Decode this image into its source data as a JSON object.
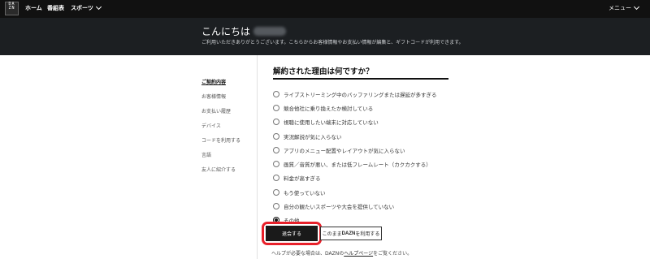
{
  "nav": {
    "logo": [
      "DA",
      "ZN"
    ],
    "home": "ホーム",
    "schedule": "番組表",
    "sports": "スポーツ",
    "menu": "メニュー"
  },
  "header": {
    "greeting": "こんにちは",
    "subtitle": "ご利用いただきありがとうございます。こちらからお客様情報やお支払い情報が編集と、ギフトコードが利用できます。"
  },
  "sidebar": {
    "items": [
      {
        "label": "ご契約内容",
        "active": true
      },
      {
        "label": "お客様情報",
        "active": false
      },
      {
        "label": "お支払い履歴",
        "active": false
      },
      {
        "label": "デバイス",
        "active": false
      },
      {
        "label": "コードを利用する",
        "active": false
      },
      {
        "label": "言語",
        "active": false
      },
      {
        "label": "友人に紹介する",
        "active": false
      }
    ]
  },
  "main": {
    "question": "解約された理由は何ですか？",
    "options": [
      {
        "label": "ライブストリーミング中のバッファリングまたは遅延が多すぎる",
        "checked": false
      },
      {
        "label": "競合他社に乗り換えたか検討している",
        "checked": false
      },
      {
        "label": "視聴に使用したい端末に対応していない",
        "checked": false
      },
      {
        "label": "実況解説が気に入らない",
        "checked": false
      },
      {
        "label": "アプリのメニュー配置やレイアウトが気に入らない",
        "checked": false
      },
      {
        "label": "画質／音質が悪い、または低フレームレート（カクカクする）",
        "checked": false
      },
      {
        "label": "料金が高すぎる",
        "checked": false
      },
      {
        "label": "もう使っていない",
        "checked": false
      },
      {
        "label": "自分の観たいスポーツや大会を提供していない",
        "checked": false
      },
      {
        "label": "その他",
        "checked": true
      }
    ],
    "cancel_label": "退会する",
    "continue_prefix": "このまま",
    "continue_brand": "DAZN",
    "continue_suffix": "を利用する",
    "help_prefix": "ヘルプが必要な場合は、DAZNの",
    "help_link": "ヘルプページ",
    "help_suffix": "をご覧ください。"
  },
  "colors": {
    "highlight": "#e8202a",
    "topbar": "#111111",
    "header": "#1c1f22"
  }
}
